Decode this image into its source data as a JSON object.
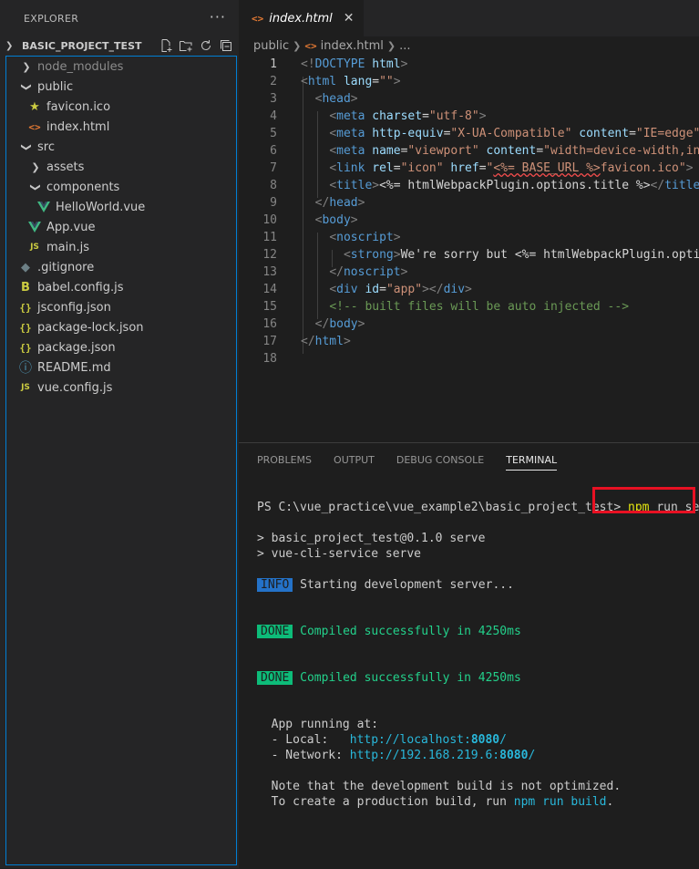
{
  "sidebar": {
    "title": "EXPLORER",
    "more": "···",
    "project": "BASIC_PROJECT_TEST",
    "items": [
      {
        "label": "node_modules",
        "kind": "folder",
        "depth": 1,
        "expanded": false,
        "dim": true
      },
      {
        "label": "public",
        "kind": "folder",
        "depth": 1,
        "expanded": true
      },
      {
        "label": "favicon.ico",
        "kind": "file",
        "icon": "star-icon",
        "depth": 2
      },
      {
        "label": "index.html",
        "kind": "file",
        "icon": "html-icon",
        "depth": 2
      },
      {
        "label": "src",
        "kind": "folder",
        "depth": 1,
        "expanded": true
      },
      {
        "label": "assets",
        "kind": "folder",
        "depth": 2,
        "expanded": false
      },
      {
        "label": "components",
        "kind": "folder",
        "depth": 2,
        "expanded": true
      },
      {
        "label": "HelloWorld.vue",
        "kind": "file",
        "icon": "vue-icon",
        "depth": 3
      },
      {
        "label": "App.vue",
        "kind": "file",
        "icon": "vue-icon",
        "depth": 2
      },
      {
        "label": "main.js",
        "kind": "file",
        "icon": "js-icon",
        "depth": 2
      },
      {
        "label": ".gitignore",
        "kind": "file",
        "icon": "git-icon",
        "depth": 1
      },
      {
        "label": "babel.config.js",
        "kind": "file",
        "icon": "babel-icon",
        "depth": 1
      },
      {
        "label": "jsconfig.json",
        "kind": "file",
        "icon": "json-icon",
        "depth": 1
      },
      {
        "label": "package-lock.json",
        "kind": "file",
        "icon": "json-icon",
        "depth": 1
      },
      {
        "label": "package.json",
        "kind": "file",
        "icon": "json-icon",
        "depth": 1
      },
      {
        "label": "README.md",
        "kind": "file",
        "icon": "info-icon",
        "depth": 1
      },
      {
        "label": "vue.config.js",
        "kind": "file",
        "icon": "js-icon",
        "depth": 1
      }
    ]
  },
  "editor": {
    "tab_label": "index.html",
    "breadcrumb": [
      "public",
      "index.html",
      "..."
    ],
    "active_line": 1,
    "lines": [
      [
        [
          "br",
          "<!"
        ],
        [
          "tag",
          "DOCTYPE"
        ],
        [
          "txt",
          " "
        ],
        [
          "attr",
          "html"
        ],
        [
          "br",
          ">"
        ]
      ],
      [
        [
          "br",
          "<"
        ],
        [
          "tag",
          "html"
        ],
        [
          "txt",
          " "
        ],
        [
          "attr",
          "lang"
        ],
        [
          "txt",
          "="
        ],
        [
          "str",
          "\"\""
        ],
        [
          "br",
          ">"
        ]
      ],
      [
        [
          "txt",
          "  "
        ],
        [
          "br",
          "<"
        ],
        [
          "tag",
          "head"
        ],
        [
          "br",
          ">"
        ]
      ],
      [
        [
          "txt",
          "    "
        ],
        [
          "br",
          "<"
        ],
        [
          "tag",
          "meta"
        ],
        [
          "txt",
          " "
        ],
        [
          "attr",
          "charset"
        ],
        [
          "txt",
          "="
        ],
        [
          "str",
          "\"utf-8\""
        ],
        [
          "br",
          ">"
        ]
      ],
      [
        [
          "txt",
          "    "
        ],
        [
          "br",
          "<"
        ],
        [
          "tag",
          "meta"
        ],
        [
          "txt",
          " "
        ],
        [
          "attr",
          "http-equiv"
        ],
        [
          "txt",
          "="
        ],
        [
          "str",
          "\"X-UA-Compatible\""
        ],
        [
          "txt",
          " "
        ],
        [
          "attr",
          "content"
        ],
        [
          "txt",
          "="
        ],
        [
          "str",
          "\"IE=edge\""
        ],
        [
          "br",
          ">"
        ]
      ],
      [
        [
          "txt",
          "    "
        ],
        [
          "br",
          "<"
        ],
        [
          "tag",
          "meta"
        ],
        [
          "txt",
          " "
        ],
        [
          "attr",
          "name"
        ],
        [
          "txt",
          "="
        ],
        [
          "str",
          "\"viewport\""
        ],
        [
          "txt",
          " "
        ],
        [
          "attr",
          "content"
        ],
        [
          "txt",
          "="
        ],
        [
          "str",
          "\"width=device-width,ini"
        ]
      ],
      [
        [
          "txt",
          "    "
        ],
        [
          "br",
          "<"
        ],
        [
          "tag",
          "link"
        ],
        [
          "txt",
          " "
        ],
        [
          "attr",
          "rel"
        ],
        [
          "txt",
          "="
        ],
        [
          "str",
          "\"icon\""
        ],
        [
          "txt",
          " "
        ],
        [
          "attr",
          "href"
        ],
        [
          "txt",
          "="
        ],
        [
          "str",
          "\""
        ],
        [
          "sq",
          "<%= BASE_URL %>"
        ],
        [
          "str",
          "favicon.ico\""
        ],
        [
          "br",
          ">"
        ]
      ],
      [
        [
          "txt",
          "    "
        ],
        [
          "br",
          "<"
        ],
        [
          "tag",
          "title"
        ],
        [
          "br",
          ">"
        ],
        [
          "txt",
          "<%= htmlWebpackPlugin.options.title %>"
        ],
        [
          "br",
          "</"
        ],
        [
          "tag",
          "title"
        ],
        [
          "br",
          ">"
        ]
      ],
      [
        [
          "txt",
          "  "
        ],
        [
          "br",
          "</"
        ],
        [
          "tag",
          "head"
        ],
        [
          "br",
          ">"
        ]
      ],
      [
        [
          "txt",
          "  "
        ],
        [
          "br",
          "<"
        ],
        [
          "tag",
          "body"
        ],
        [
          "br",
          ">"
        ]
      ],
      [
        [
          "txt",
          "    "
        ],
        [
          "br",
          "<"
        ],
        [
          "tag",
          "noscript"
        ],
        [
          "br",
          ">"
        ]
      ],
      [
        [
          "txt",
          "      "
        ],
        [
          "br",
          "<"
        ],
        [
          "tag",
          "strong"
        ],
        [
          "br",
          ">"
        ],
        [
          "txt",
          "We're sorry but <%= htmlWebpackPlugin.optio"
        ]
      ],
      [
        [
          "txt",
          "    "
        ],
        [
          "br",
          "</"
        ],
        [
          "tag",
          "noscript"
        ],
        [
          "br",
          ">"
        ]
      ],
      [
        [
          "txt",
          "    "
        ],
        [
          "br",
          "<"
        ],
        [
          "tag",
          "div"
        ],
        [
          "txt",
          " "
        ],
        [
          "attr",
          "id"
        ],
        [
          "txt",
          "="
        ],
        [
          "str",
          "\"app\""
        ],
        [
          "br",
          "></"
        ],
        [
          "tag",
          "div"
        ],
        [
          "br",
          ">"
        ]
      ],
      [
        [
          "txt",
          "    "
        ],
        [
          "com",
          "<!-- built files will be auto injected -->"
        ]
      ],
      [
        [
          "txt",
          "  "
        ],
        [
          "br",
          "</"
        ],
        [
          "tag",
          "body"
        ],
        [
          "br",
          ">"
        ]
      ],
      [
        [
          "br",
          "</"
        ],
        [
          "tag",
          "html"
        ],
        [
          "br",
          ">"
        ]
      ],
      []
    ]
  },
  "panel": {
    "tabs": [
      "PROBLEMS",
      "OUTPUT",
      "DEBUG CONSOLE",
      "TERMINAL"
    ],
    "active_tab": "TERMINAL",
    "terminal": {
      "prompt": "PS C:\\vue_practice\\vue_example2\\basic_project_test>",
      "cmd_npm": "npm",
      "cmd_rest": "run serve",
      "serve_line1": "> basic_project_test@0.1.0 serve",
      "serve_line2": "> vue-cli-service serve",
      "info_badge": "INFO",
      "info_text": "Starting development server...",
      "done_badge": "DONE",
      "done_text": "Compiled successfully in 4250ms",
      "app_running": "  App running at:",
      "local_label": "  - Local:   ",
      "local_url_pre": "http://localhost:",
      "local_port": "8080",
      "local_url_post": "/",
      "network_label": "  - Network: ",
      "network_url_pre": "http://192.168.219.6:",
      "network_port": "8080",
      "network_url_post": "/",
      "note1": "  Note that the development build is not optimized.",
      "note2_pre": "  To create a production build, run ",
      "note2_cmd": "npm run build",
      "note2_post": "."
    }
  },
  "colors": {
    "highlight_box": "#e81123",
    "vue_green": "#41b883",
    "focus_border": "#007fd4"
  }
}
